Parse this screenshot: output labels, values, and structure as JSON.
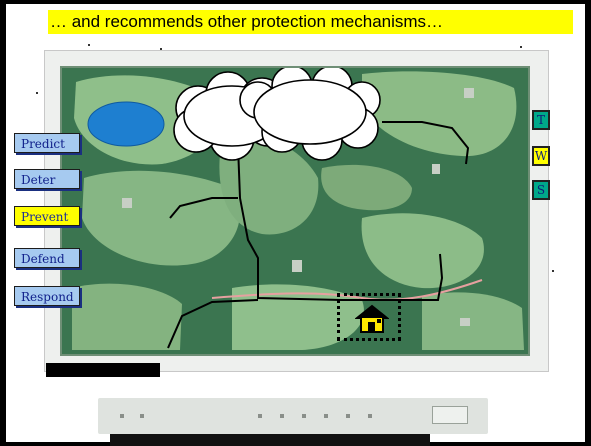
{
  "banner": {
    "text": "… and recommends other protection mechanisms…"
  },
  "menu": {
    "items": [
      {
        "label": "Predict",
        "active": false
      },
      {
        "label": "Deter",
        "active": false
      },
      {
        "label": "Prevent",
        "active": true
      },
      {
        "label": "Defend",
        "active": false
      },
      {
        "label": "Respond",
        "active": false
      }
    ]
  },
  "side_buttons": {
    "items": [
      {
        "label": "T",
        "active": false
      },
      {
        "label": "W",
        "active": true
      },
      {
        "label": "S",
        "active": false
      }
    ]
  },
  "colors": {
    "banner": "#ffff00",
    "menu_button": "#a6caf0",
    "menu_active": "#ffff00",
    "side_button": "#00a88a",
    "map_green": "#3f7d56",
    "water": "#1e7fd0",
    "house": "#ffe800"
  },
  "icons": [
    "cloud-icon",
    "house-icon",
    "lake-icon"
  ]
}
